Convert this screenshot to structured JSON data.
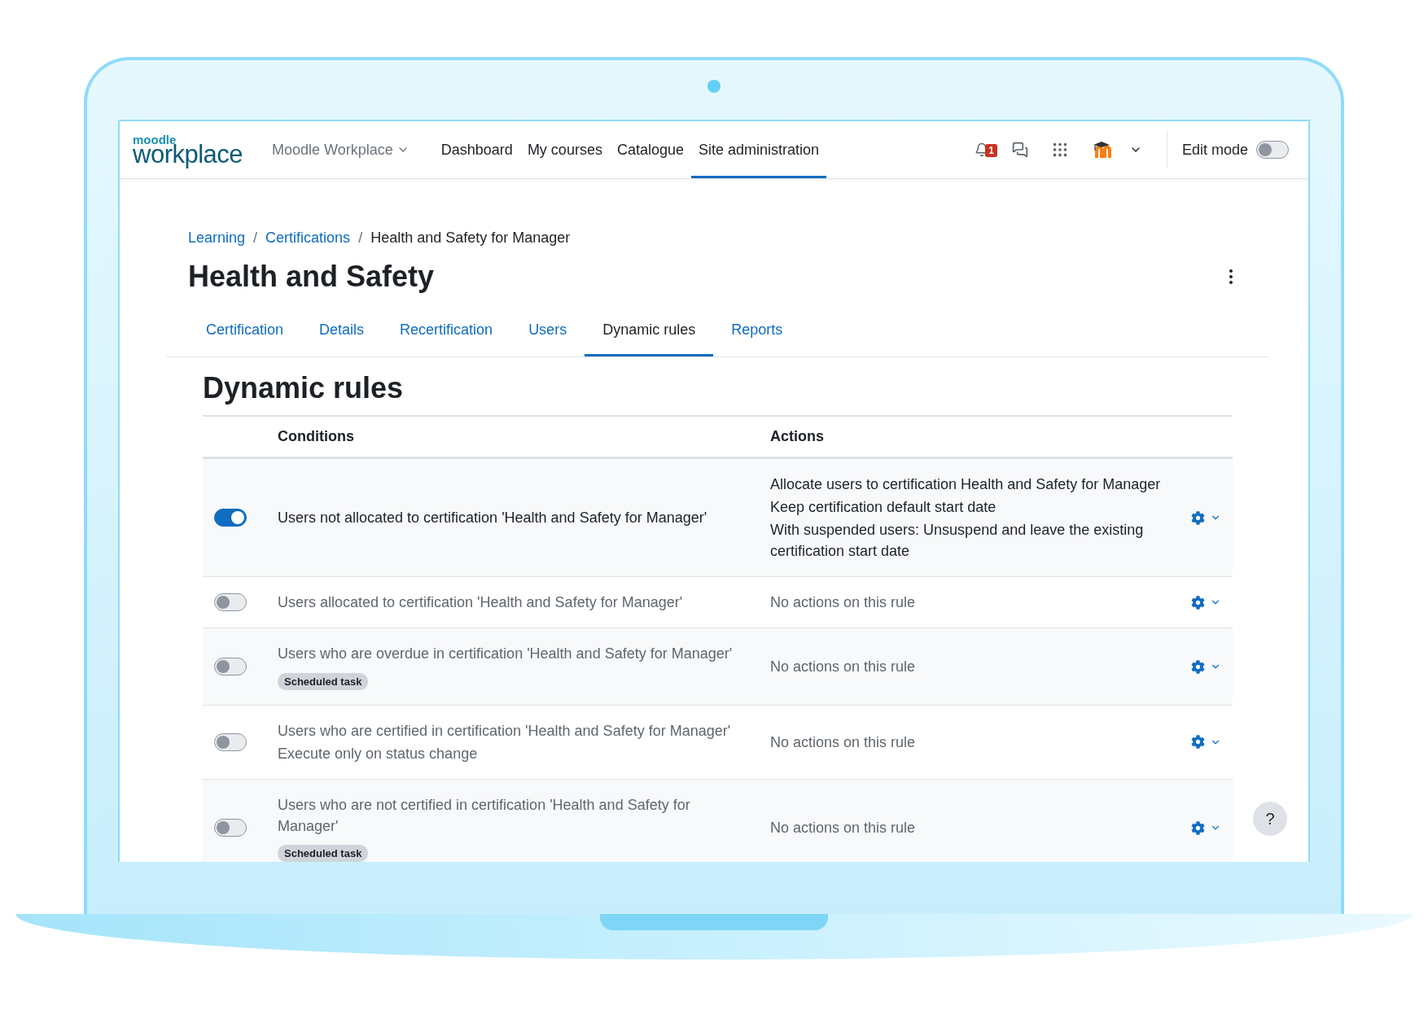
{
  "logo": {
    "small": "moodle",
    "large": "workplace"
  },
  "nav": {
    "site_menu": "Moodle Workplace",
    "items": [
      {
        "label": "Dashboard",
        "selected": false
      },
      {
        "label": "My courses",
        "selected": false
      },
      {
        "label": "Catalogue",
        "selected": false
      },
      {
        "label": "Site administration",
        "selected": true
      }
    ]
  },
  "notifications": {
    "count": "1"
  },
  "edit_mode": {
    "label": "Edit mode",
    "on": false
  },
  "breadcrumb": [
    {
      "kind": "link",
      "label": "Learning"
    },
    {
      "kind": "separator",
      "label": "/"
    },
    {
      "kind": "link",
      "label": "Certifications"
    },
    {
      "kind": "separator",
      "label": "/"
    },
    {
      "kind": "current",
      "label": "Health and Safety for Manager"
    }
  ],
  "page_title": "Health and Safety",
  "tabs": [
    {
      "label": "Certification",
      "selected": false
    },
    {
      "label": "Details",
      "selected": false
    },
    {
      "label": "Recertification",
      "selected": false
    },
    {
      "label": "Users",
      "selected": false
    },
    {
      "label": "Dynamic rules",
      "selected": true
    },
    {
      "label": "Reports",
      "selected": false
    }
  ],
  "section_title": "Dynamic rules",
  "table": {
    "columns": [
      "Conditions",
      "Actions"
    ],
    "rows": [
      {
        "enabled": true,
        "conditions": [
          "Users not allocated to certification 'Health and Safety for Manager'"
        ],
        "actions": [
          "Allocate users to certification Health and Safety for Manager",
          "Keep certification default start date",
          "With suspended users: Unsuspend and leave the existing certification start date"
        ]
      },
      {
        "enabled": false,
        "conditions": [
          "Users allocated to certification 'Health and Safety for Manager'"
        ],
        "actions": [
          "No actions on this rule"
        ]
      },
      {
        "enabled": false,
        "conditions": [
          "Users who are overdue in certification 'Health and Safety for Manager'"
        ],
        "badge": "Scheduled task",
        "actions": [
          "No actions on this rule"
        ]
      },
      {
        "enabled": false,
        "conditions": [
          "Users who are certified in certification 'Health and Safety for Manager'",
          "Execute only on status change"
        ],
        "actions": [
          "No actions on this rule"
        ]
      },
      {
        "enabled": false,
        "conditions": [
          "Users who are not certified in certification 'Health and Safety for Manager'"
        ],
        "badge": "Scheduled task",
        "actions": [
          "No actions on this rule"
        ]
      }
    ]
  },
  "help_button": "?"
}
